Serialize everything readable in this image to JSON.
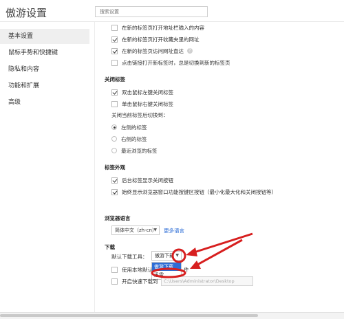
{
  "header": {
    "title": "傲游设置",
    "search_placeholder": "搜索设置"
  },
  "sidebar": {
    "items": [
      {
        "label": "基本设置",
        "active": true
      },
      {
        "label": "鼠标手势和快捷键",
        "active": false
      },
      {
        "label": "隐私和内容",
        "active": false
      },
      {
        "label": "功能和扩展",
        "active": false
      },
      {
        "label": "高级",
        "active": false
      }
    ]
  },
  "tab_open": {
    "options": [
      {
        "label": "在新的标签页打开地址栏输入的内容",
        "checked": false
      },
      {
        "label": "在新的标签页打开收藏夹里的网址",
        "checked": true
      },
      {
        "label": "在新的标签页访问网址直达",
        "checked": true,
        "help_icon": "?"
      },
      {
        "label": "点击链接打开新标签时，总是切换到新的标签页",
        "checked": false
      }
    ]
  },
  "close_tab": {
    "heading": "关闭标签",
    "options": [
      {
        "label": "双击鼠标左键关闭标签",
        "checked": true
      },
      {
        "label": "单击鼠标右键关闭标签",
        "checked": false
      }
    ],
    "switch_label": "关闭当前标签后切换到：",
    "switch_options": [
      {
        "label": "左侧的标签",
        "selected": true
      },
      {
        "label": "右侧的标签",
        "selected": false
      },
      {
        "label": "最近浏览的标签",
        "selected": false
      }
    ]
  },
  "tab_appearance": {
    "heading": "标签外观",
    "options": [
      {
        "label": "后台标签显示关闭按钮",
        "checked": true
      },
      {
        "label": "始终显示浏览器窗口功能按键区按钮（最小化最大化和关闭按钮等）",
        "checked": true
      }
    ]
  },
  "language": {
    "heading": "浏览器语言",
    "value": "简体中文（zh-cn）",
    "more_link": "更多语言"
  },
  "download": {
    "heading": "下载",
    "tool_label": "默认下载工具：",
    "tool_value": "傲游下载",
    "dropdown_options": [
      {
        "label": "傲游下载",
        "selected": true
      },
      {
        "label": "迅雷",
        "selected": false
      }
    ],
    "use_local_label": "使用本地默认",
    "use_local_suffix": "件",
    "use_local_checked": false,
    "quick_label": "开启快速下载到",
    "quick_checked": false,
    "quick_path": "C:\\Users\\Administrator\\Desktop"
  },
  "colors": {
    "annotation": "#d71f1f",
    "link": "#2a6bd6",
    "dropdown_selected": "#2d6dd6"
  }
}
